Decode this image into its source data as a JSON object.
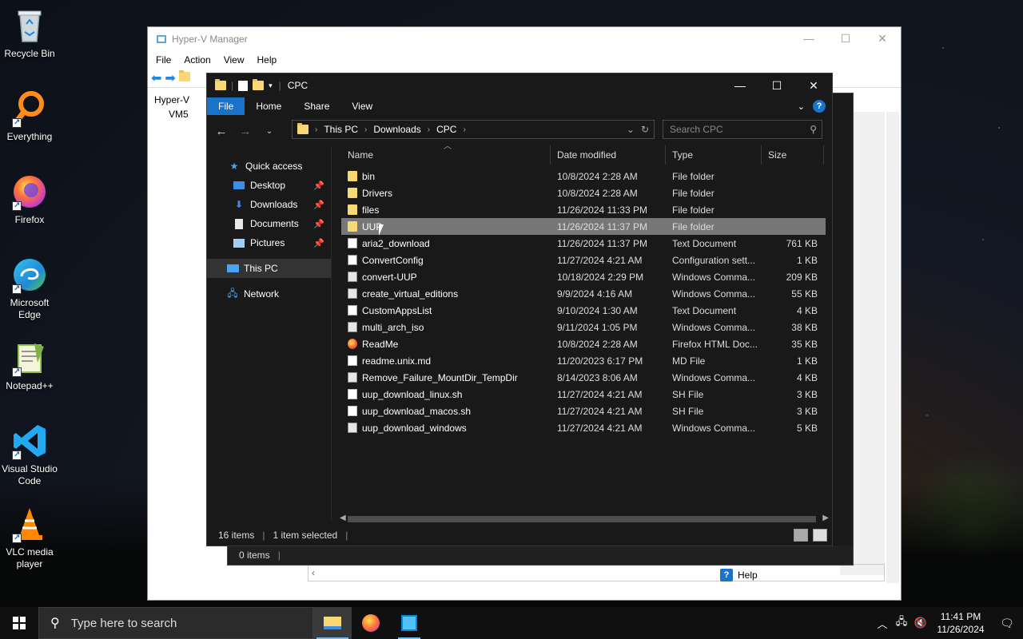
{
  "desktop": {
    "icons": [
      {
        "label": "Recycle Bin",
        "icon": "recycle-bin-icon"
      },
      {
        "label": "Everything",
        "icon": "everything-icon"
      },
      {
        "label": "Firefox",
        "icon": "firefox-icon"
      },
      {
        "label": "Microsoft Edge",
        "icon": "edge-icon"
      },
      {
        "label": "Notepad++",
        "icon": "notepadpp-icon"
      },
      {
        "label": "Visual Studio Code",
        "icon": "vscode-icon"
      },
      {
        "label": "VLC media player",
        "icon": "vlc-icon"
      }
    ]
  },
  "hyperv": {
    "title": "Hyper-V Manager",
    "menu": [
      "File",
      "Action",
      "View",
      "Help"
    ],
    "tree": [
      "Hyper-V",
      "VM5"
    ],
    "help_label": "Help"
  },
  "explorer_back": {
    "status": "0 items"
  },
  "explorer": {
    "title": "CPC",
    "ribbon_tabs": [
      "File",
      "Home",
      "Share",
      "View"
    ],
    "breadcrumb": [
      "This PC",
      "Downloads",
      "CPC"
    ],
    "search_placeholder": "Search CPC",
    "nav": {
      "quick_access": "Quick access",
      "desktop": "Desktop",
      "downloads": "Downloads",
      "documents": "Documents",
      "pictures": "Pictures",
      "this_pc": "This PC",
      "network": "Network"
    },
    "columns": {
      "name": "Name",
      "date": "Date modified",
      "type": "Type",
      "size": "Size"
    },
    "files": [
      {
        "name": "bin",
        "date": "10/8/2024 2:28 AM",
        "type": "File folder",
        "size": "",
        "icon": "folder"
      },
      {
        "name": "Drivers",
        "date": "10/8/2024 2:28 AM",
        "type": "File folder",
        "size": "",
        "icon": "folder"
      },
      {
        "name": "files",
        "date": "11/26/2024 11:33 PM",
        "type": "File folder",
        "size": "",
        "icon": "folder"
      },
      {
        "name": "UUP",
        "date": "11/26/2024 11:37 PM",
        "type": "File folder",
        "size": "",
        "icon": "folder",
        "selected": true
      },
      {
        "name": "aria2_download",
        "date": "11/26/2024 11:37 PM",
        "type": "Text Document",
        "size": "761 KB",
        "icon": "text"
      },
      {
        "name": "ConvertConfig",
        "date": "11/27/2024 4:21 AM",
        "type": "Configuration sett...",
        "size": "1 KB",
        "icon": "config"
      },
      {
        "name": "convert-UUP",
        "date": "10/18/2024 2:29 PM",
        "type": "Windows Comma...",
        "size": "209 KB",
        "icon": "cmd"
      },
      {
        "name": "create_virtual_editions",
        "date": "9/9/2024 4:16 AM",
        "type": "Windows Comma...",
        "size": "55 KB",
        "icon": "cmd"
      },
      {
        "name": "CustomAppsList",
        "date": "9/10/2024 1:30 AM",
        "type": "Text Document",
        "size": "4 KB",
        "icon": "text"
      },
      {
        "name": "multi_arch_iso",
        "date": "9/11/2024 1:05 PM",
        "type": "Windows Comma...",
        "size": "38 KB",
        "icon": "cmd"
      },
      {
        "name": "ReadMe",
        "date": "10/8/2024 2:28 AM",
        "type": "Firefox HTML Doc...",
        "size": "35 KB",
        "icon": "firefox"
      },
      {
        "name": "readme.unix.md",
        "date": "11/20/2023 6:17 PM",
        "type": "MD File",
        "size": "1 KB",
        "icon": "md"
      },
      {
        "name": "Remove_Failure_MountDir_TempDir",
        "date": "8/14/2023 8:06 AM",
        "type": "Windows Comma...",
        "size": "4 KB",
        "icon": "cmd"
      },
      {
        "name": "uup_download_linux.sh",
        "date": "11/27/2024 4:21 AM",
        "type": "SH File",
        "size": "3 KB",
        "icon": "md"
      },
      {
        "name": "uup_download_macos.sh",
        "date": "11/27/2024 4:21 AM",
        "type": "SH File",
        "size": "3 KB",
        "icon": "md"
      },
      {
        "name": "uup_download_windows",
        "date": "11/27/2024 4:21 AM",
        "type": "Windows Comma...",
        "size": "5 KB",
        "icon": "cmd"
      }
    ],
    "status_items": "16 items",
    "status_selected": "1 item selected"
  },
  "taskbar": {
    "search_placeholder": "Type here to search",
    "time": "11:41 PM",
    "date": "11/26/2024"
  }
}
